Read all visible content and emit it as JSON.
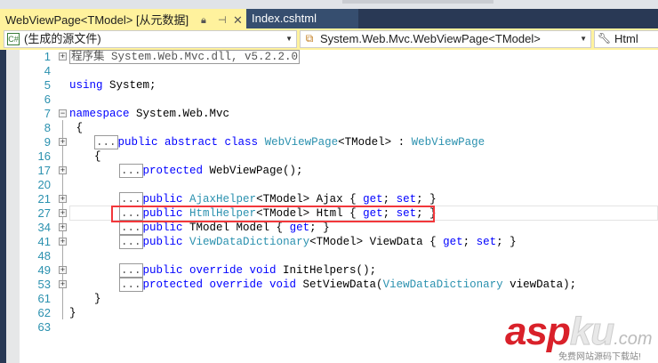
{
  "tabs": [
    {
      "label": "WebViewPage<TModel> [从元数据]",
      "active": true
    },
    {
      "label": "Index.cshtml",
      "active": false
    }
  ],
  "tab_icons": [
    "lock-icon",
    "pin-icon",
    "close-icon"
  ],
  "navbar": {
    "project": "(生成的源文件)",
    "project_icon": "C#",
    "type": "System.Web.Mvc.WebViewPage<TModel>",
    "member": "Html"
  },
  "code_lines": [
    {
      "n": "1",
      "fold": "+",
      "indent": 0,
      "tokens": [
        [
          "pl",
          "程序集 System.Web.Mvc.dll, v5.2.2.0",
          "box"
        ]
      ]
    },
    {
      "n": "4",
      "tokens": []
    },
    {
      "n": "5",
      "indent": 0,
      "tokens": [
        [
          "kw",
          "using"
        ],
        [
          "pl",
          " System;"
        ]
      ]
    },
    {
      "n": "6",
      "tokens": []
    },
    {
      "n": "7",
      "fold": "-",
      "indent": 0,
      "tokens": [
        [
          "kw",
          "namespace"
        ],
        [
          "pl",
          " System.Web.Mvc"
        ]
      ]
    },
    {
      "n": "8",
      "indent": 0,
      "tokens": [
        [
          "pl",
          " {"
        ]
      ]
    },
    {
      "n": "9",
      "fold": "+",
      "indent": 4,
      "tokens": [
        [
          "pl",
          "...",
          "box"
        ],
        [
          "kw",
          "public abstract class"
        ],
        [
          "pl",
          " "
        ],
        [
          "ty",
          "WebViewPage"
        ],
        [
          "pl",
          "<TModel> : "
        ],
        [
          "ty",
          "WebViewPage"
        ]
      ]
    },
    {
      "n": "16",
      "indent": 4,
      "tokens": [
        [
          "pl",
          "{"
        ]
      ]
    },
    {
      "n": "17",
      "fold": "+",
      "indent": 8,
      "tokens": [
        [
          "pl",
          "...",
          "box"
        ],
        [
          "kw",
          "protected"
        ],
        [
          "pl",
          " WebViewPage();"
        ]
      ]
    },
    {
      "n": "20",
      "tokens": []
    },
    {
      "n": "21",
      "fold": "+",
      "indent": 8,
      "tokens": [
        [
          "pl",
          "...",
          "box"
        ],
        [
          "kw",
          "public"
        ],
        [
          "pl",
          " "
        ],
        [
          "ty",
          "AjaxHelper"
        ],
        [
          "pl",
          "<TModel> Ajax { "
        ],
        [
          "kw",
          "get"
        ],
        [
          "pl",
          "; "
        ],
        [
          "kw",
          "set"
        ],
        [
          "pl",
          "; }"
        ]
      ]
    },
    {
      "n": "27",
      "fold": "+",
      "indent": 8,
      "tokens": [
        [
          "pl",
          "...",
          "box"
        ],
        [
          "kw",
          "public"
        ],
        [
          "pl",
          " "
        ],
        [
          "ty",
          "HtmlHelper"
        ],
        [
          "pl",
          "<TModel> Html { "
        ],
        [
          "kw",
          "get"
        ],
        [
          "pl",
          "; "
        ],
        [
          "kw",
          "set"
        ],
        [
          "pl",
          "; }"
        ]
      ]
    },
    {
      "n": "34",
      "fold": "+",
      "indent": 8,
      "tokens": [
        [
          "pl",
          "...",
          "box"
        ],
        [
          "kw",
          "public"
        ],
        [
          "pl",
          " TModel Model { "
        ],
        [
          "kw",
          "get"
        ],
        [
          "pl",
          "; }"
        ]
      ]
    },
    {
      "n": "41",
      "fold": "+",
      "indent": 8,
      "tokens": [
        [
          "pl",
          "...",
          "box"
        ],
        [
          "kw",
          "public"
        ],
        [
          "pl",
          " "
        ],
        [
          "ty",
          "ViewDataDictionary"
        ],
        [
          "pl",
          "<TModel> ViewData { "
        ],
        [
          "kw",
          "get"
        ],
        [
          "pl",
          "; "
        ],
        [
          "kw",
          "set"
        ],
        [
          "pl",
          "; }"
        ]
      ]
    },
    {
      "n": "48",
      "tokens": []
    },
    {
      "n": "49",
      "fold": "+",
      "indent": 8,
      "tokens": [
        [
          "pl",
          "...",
          "box"
        ],
        [
          "kw",
          "public override void"
        ],
        [
          "pl",
          " InitHelpers();"
        ]
      ]
    },
    {
      "n": "53",
      "fold": "+",
      "indent": 8,
      "tokens": [
        [
          "pl",
          "...",
          "box"
        ],
        [
          "kw",
          "protected override void"
        ],
        [
          "pl",
          " SetViewData("
        ],
        [
          "ty",
          "ViewDataDictionary"
        ],
        [
          "pl",
          " viewData);"
        ]
      ]
    },
    {
      "n": "61",
      "indent": 4,
      "tokens": [
        [
          "pl",
          "}"
        ]
      ]
    },
    {
      "n": "62",
      "indent": 0,
      "tokens": [
        [
          "pl",
          "}"
        ]
      ]
    },
    {
      "n": "63",
      "tokens": []
    }
  ],
  "watermark": {
    "brand": "asp",
    "brand2": "ku",
    ".com": ".com",
    "tagline": "免费网站源码下载站!"
  }
}
